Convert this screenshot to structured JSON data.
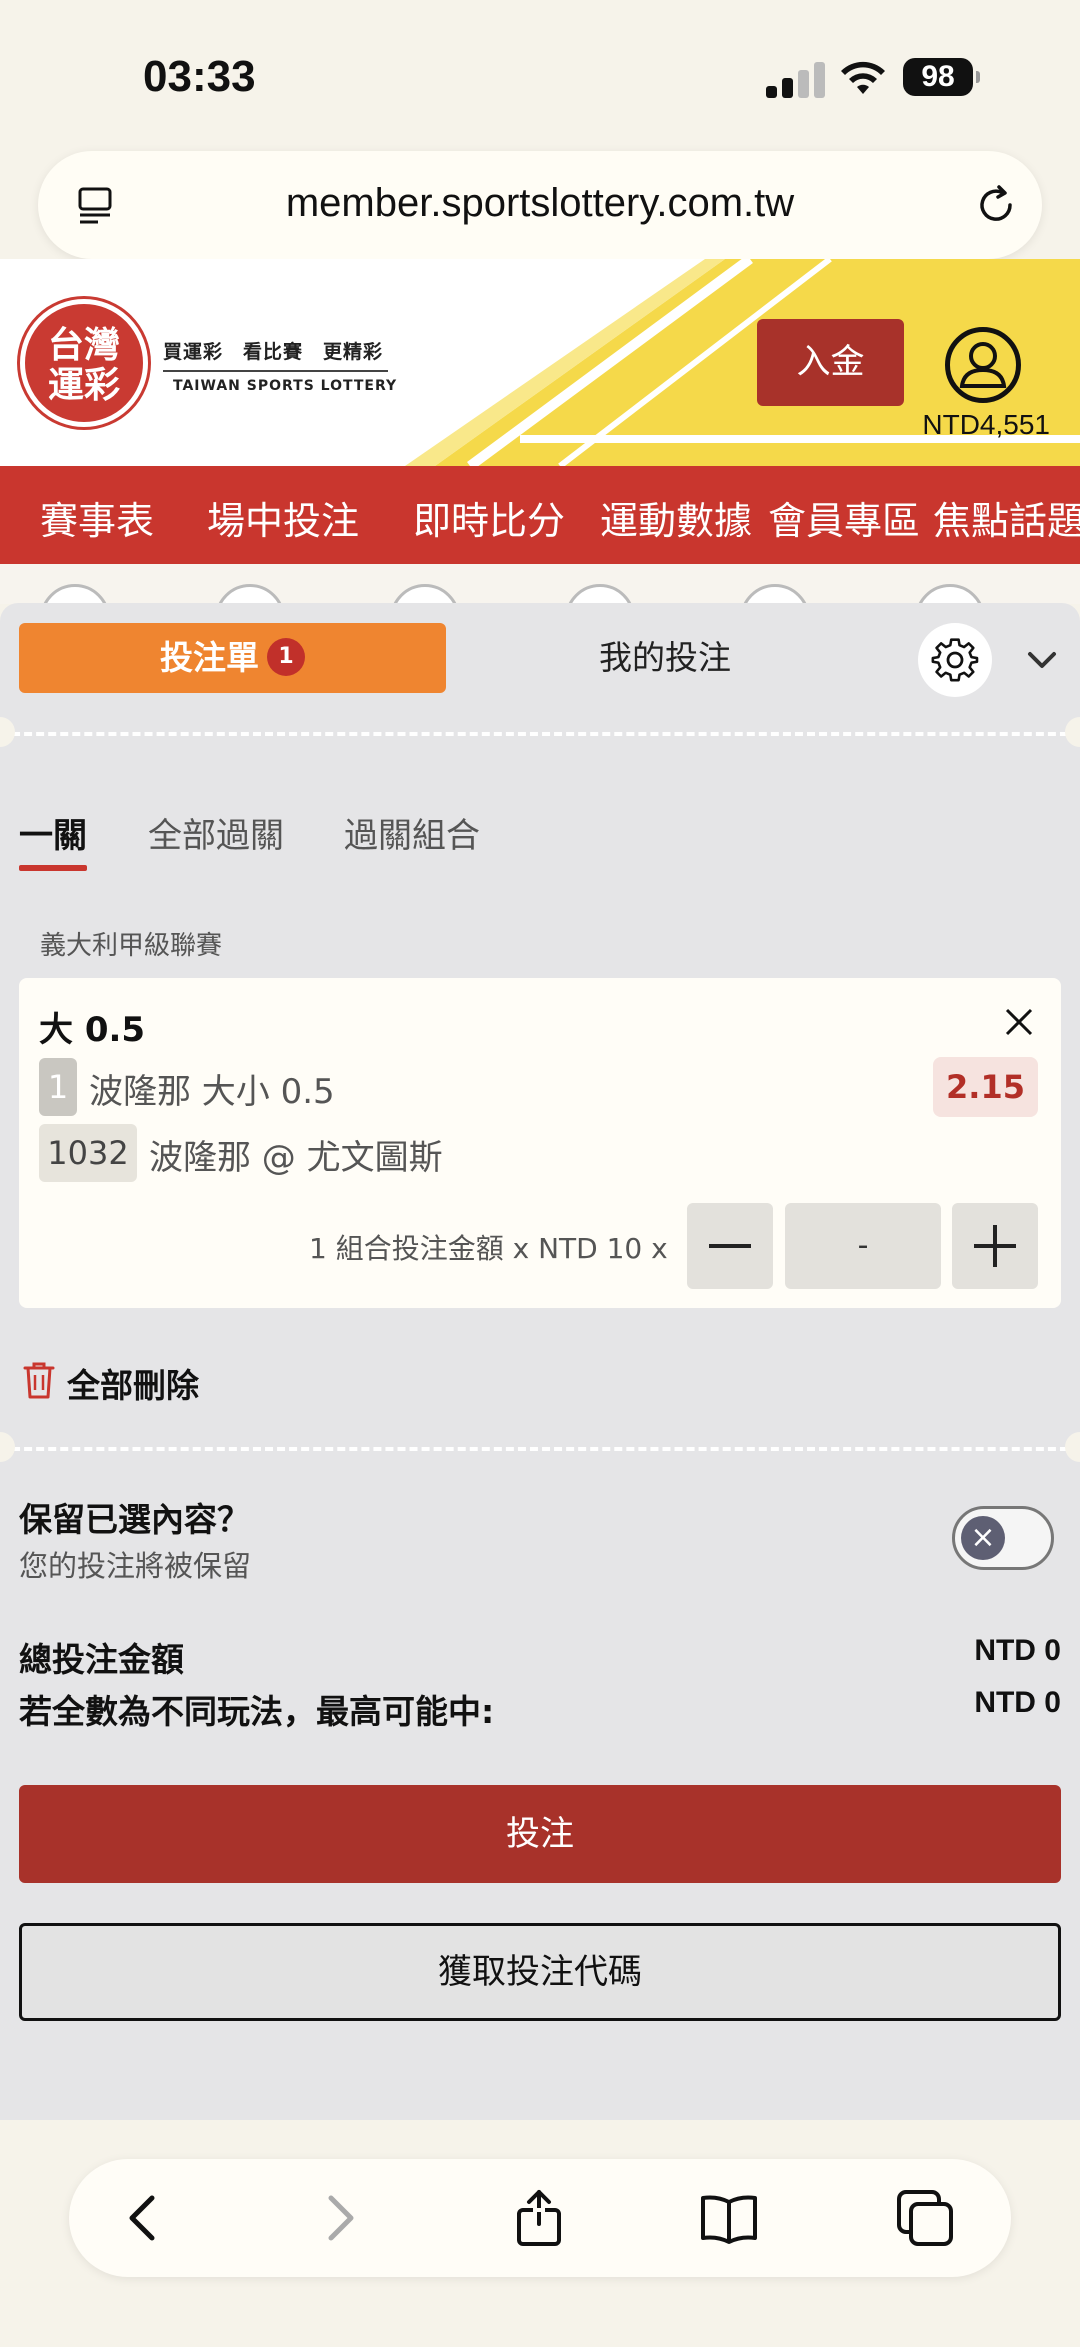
{
  "status_bar": {
    "time": "03:33",
    "battery": "98"
  },
  "browser": {
    "url": "member.sportslottery.com.tw"
  },
  "header": {
    "logo_line1": "台灣",
    "logo_line2": "運彩",
    "slogan": "買運彩　看比賽　更精彩",
    "logo_english": "TAIWAN SPORTS LOTTERY",
    "deposit_label": "入金",
    "balance": "NTD4,551"
  },
  "nav": {
    "items": [
      "賽事表",
      "場中投注",
      "即時比分",
      "運動數據",
      "會員專區",
      "焦點話題"
    ]
  },
  "betslip": {
    "slip_tab_label": "投注單",
    "slip_count": "1",
    "my_bets_label": "我的投注",
    "subtabs": [
      "一關",
      "全部過關",
      "過關組合"
    ],
    "league": "義大利甲級聯賽",
    "selection": {
      "title": "大 0.5",
      "leg_number": "1",
      "market": "波隆那 大小 0.5",
      "odds": "2.15",
      "match_code": "1032",
      "match": "波隆那 @ 尤文圖斯",
      "stake_label": "1 組合投注金額 x NTD 10 x",
      "stake_value": "-"
    },
    "delete_all_label": "全部刪除",
    "keep_title": "保留已選內容？",
    "keep_subtitle": "您的投注將被保留",
    "total_stake_label": "總投注金額",
    "total_stake_value": "NTD 0",
    "max_win_label": "若全數為不同玩法，最高可能中:",
    "max_win_value": "NTD 0",
    "bet_button": "投注",
    "code_button": "獲取投注代碼"
  },
  "colors": {
    "brand_red": "#c9362e",
    "button_red": "#a8322a",
    "orange": "#ef8530",
    "yellow": "#f5d94a"
  }
}
